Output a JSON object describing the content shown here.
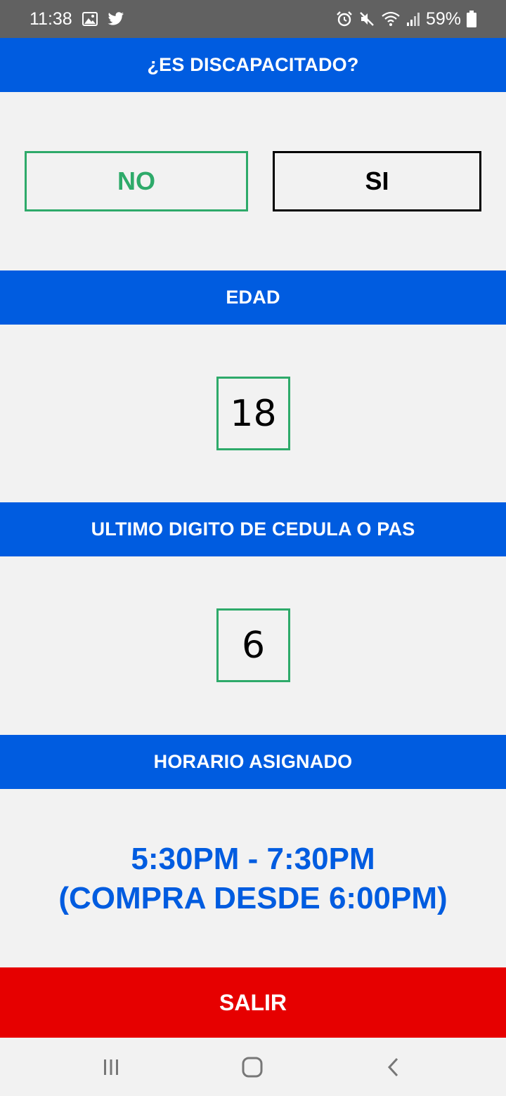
{
  "status_bar": {
    "time": "11:38",
    "battery": "59%",
    "icons": [
      "image-icon",
      "twitter-icon",
      "alarm-icon",
      "mute-icon",
      "wifi-icon",
      "signal-icon",
      "battery-icon"
    ]
  },
  "disability": {
    "header": "¿ES DISCAPACITADO?",
    "no_label": "NO",
    "si_label": "SI"
  },
  "age": {
    "header": "EDAD",
    "value": "18"
  },
  "id_digit": {
    "header": "ULTIMO DIGITO DE CEDULA O PAS",
    "value": "6"
  },
  "schedule": {
    "header": "HORARIO ASIGNADO",
    "line1": "5:30PM - 7:30PM",
    "line2": "(COMPRA DESDE 6:00PM)"
  },
  "exit": {
    "label": "SALIR"
  },
  "nav": {
    "icons": [
      "recent-apps-icon",
      "home-icon",
      "back-icon"
    ]
  },
  "colors": {
    "header_blue": "#005ce0",
    "selected_green": "#2eaa6a",
    "exit_red": "#e60000",
    "status_gray": "#616161",
    "background": "#f2f2f2"
  }
}
